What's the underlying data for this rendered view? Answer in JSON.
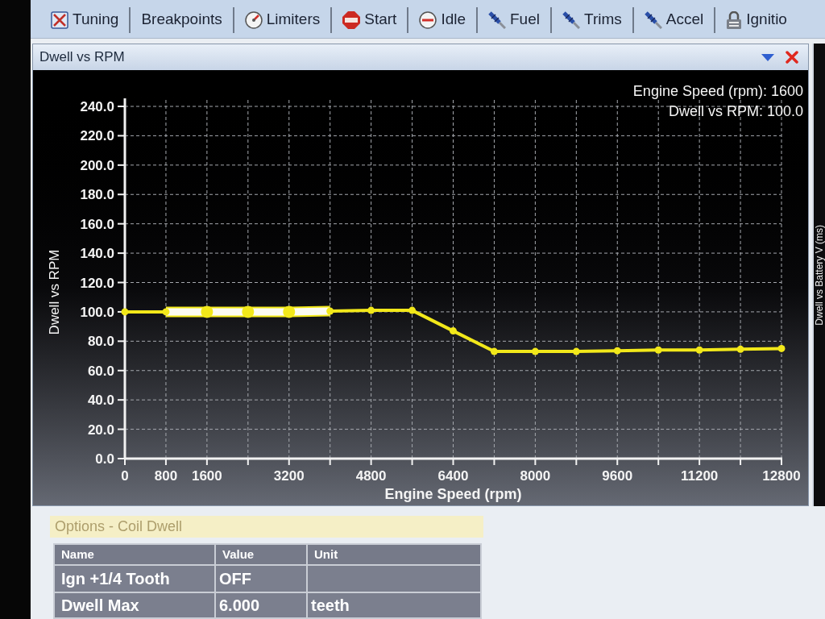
{
  "tabs": [
    {
      "label": "Tuning",
      "kind": "tools"
    },
    {
      "label": "Breakpoints",
      "kind": "plain"
    },
    {
      "label": "Limiters",
      "kind": "gauge"
    },
    {
      "label": "Start",
      "kind": "stop"
    },
    {
      "label": "Idle",
      "kind": "dial"
    },
    {
      "label": "Fuel",
      "kind": "injector"
    },
    {
      "label": "Trims",
      "kind": "injector"
    },
    {
      "label": "Accel",
      "kind": "injector"
    },
    {
      "label": "Ignitio",
      "kind": "lock"
    }
  ],
  "chart_panel": {
    "title": "Dwell vs RPM",
    "readout": [
      "Engine Speed (rpm): 1600",
      "Dwell vs RPM: 100.0"
    ],
    "chart_data": {
      "type": "line",
      "xlabel": "Engine Speed (rpm)",
      "ylabel": "Dwell vs RPM",
      "x": [
        0,
        800,
        1600,
        2400,
        3200,
        4000,
        4800,
        5600,
        6400,
        7200,
        8000,
        8800,
        9600,
        10400,
        11200,
        12000,
        12800
      ],
      "series": [
        {
          "color": "#f2e81a",
          "marker": "circle",
          "values": [
            100,
            100,
            100,
            100,
            100,
            100.5,
            101,
            101,
            87,
            73,
            73,
            73,
            73.5,
            74,
            74,
            74.5,
            75
          ]
        }
      ],
      "xlim": [
        0,
        12800
      ],
      "ylim": [
        0,
        240
      ],
      "xticks": [
        0,
        800,
        1600,
        3200,
        4800,
        6400,
        8000,
        9600,
        11200,
        12800
      ],
      "yticks": [
        {
          "value": 0,
          "label": "0.0"
        },
        {
          "value": 20,
          "label": "20.0"
        },
        {
          "value": 40,
          "label": "40.0"
        },
        {
          "value": 60,
          "label": "60.0"
        },
        {
          "value": 80,
          "label": "80.0"
        },
        {
          "value": 100,
          "label": "100.0"
        },
        {
          "value": 120,
          "label": "120.0"
        },
        {
          "value": 140,
          "label": "140.0"
        },
        {
          "value": 160,
          "label": "160.0"
        },
        {
          "value": 180,
          "label": "180.0"
        },
        {
          "value": 200,
          "label": "200.0"
        },
        {
          "value": 220,
          "label": "220.0"
        },
        {
          "value": 240,
          "label": "240.0"
        }
      ],
      "grid": true
    },
    "points": [
      {
        "selected": false
      },
      {
        "selected": false
      },
      {
        "selected": true
      },
      {
        "selected": true
      },
      {
        "selected": true
      },
      {
        "selected": false
      },
      {
        "selected": false
      },
      {
        "selected": false
      },
      {
        "selected": false
      },
      {
        "selected": false
      },
      {
        "selected": false
      },
      {
        "selected": false
      },
      {
        "selected": false
      },
      {
        "selected": false
      },
      {
        "selected": false
      },
      {
        "selected": false
      },
      {
        "selected": false
      }
    ]
  },
  "side_panel": {
    "axis_label": "Dwell vs Battery V (ms)"
  },
  "options": {
    "title": "Options - Coil Dwell",
    "columns": [
      "Name",
      "Value",
      "Unit"
    ],
    "rows": [
      {
        "name": "Ign +1/4 Tooth",
        "value": "OFF"
      },
      {
        "name": "Dwell Max",
        "value": "6.000",
        "unit": "teeth"
      }
    ]
  }
}
